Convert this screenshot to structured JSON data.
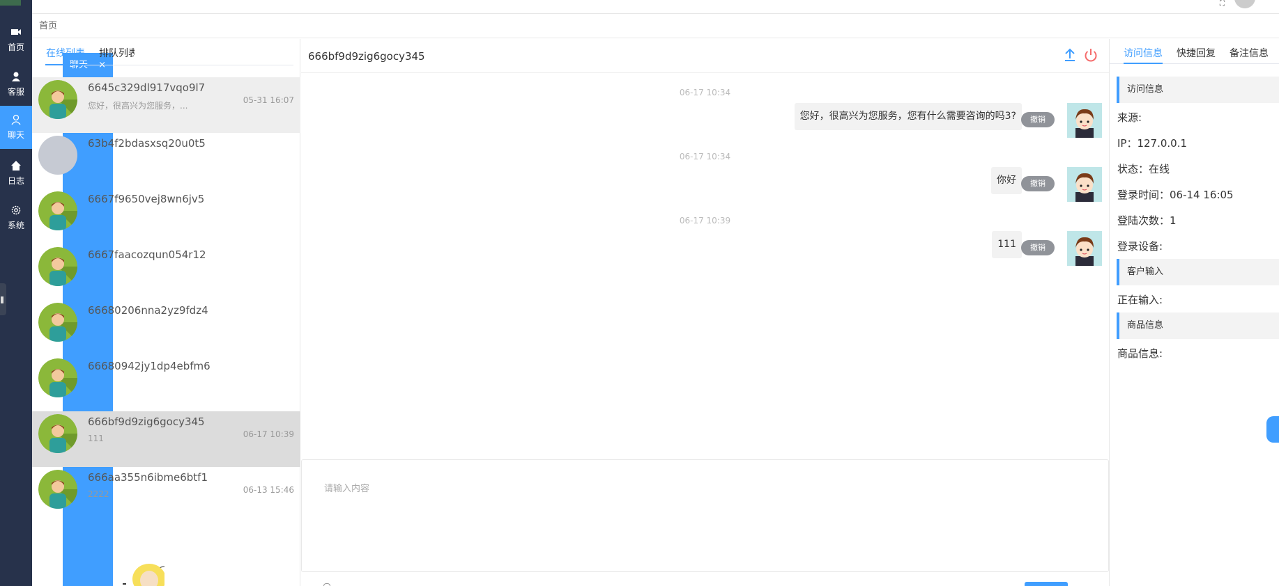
{
  "nav": {
    "items": [
      {
        "label": "首页",
        "icon": "video-camera-icon"
      },
      {
        "label": "客服",
        "icon": "user-filled-icon"
      },
      {
        "label": "聊天",
        "icon": "user-icon"
      },
      {
        "label": "日志",
        "icon": "home-icon"
      },
      {
        "label": "系统",
        "icon": "gear-icon"
      }
    ]
  },
  "tabs": {
    "home": "首页",
    "chat": "聊天",
    "close": "×"
  },
  "list": {
    "tabs": [
      "在线列表",
      "排队列表"
    ],
    "items": [
      {
        "name": "6645c329dl917vqo9l7",
        "preview": "您好，很高兴为您服务，...",
        "time": "05-31 16:07"
      },
      {
        "name": "63b4f2bdasxsq20u0t5",
        "preview": "",
        "time": ""
      },
      {
        "name": "6667f9650vej8wn6jv5",
        "preview": "",
        "time": ""
      },
      {
        "name": "6667faacozqun054r12",
        "preview": "",
        "time": ""
      },
      {
        "name": "66680206nna2yz9fdz4",
        "preview": "",
        "time": ""
      },
      {
        "name": "66680942jy1dp4ebfm6",
        "preview": "",
        "time": ""
      },
      {
        "name": "666bf9d9zig6gocy345",
        "preview": "111",
        "time": "06-17 10:39"
      },
      {
        "name": "666aa355n6ibme6btf1",
        "preview": "2222",
        "time": "06-13 15:46"
      }
    ]
  },
  "chat": {
    "title": "666bf9d9zig6gocy345",
    "messages": [
      {
        "time": "06-17 10:34",
        "text": "您好，很高兴为您服务，您有什么需要咨询的吗3?",
        "revoke": "撤销"
      },
      {
        "time": "06-17 10:34",
        "text": "你好",
        "revoke": "撤销"
      },
      {
        "time": "06-17 10:39",
        "text": "111",
        "revoke": "撤销"
      }
    ],
    "input_placeholder": "请输入内容"
  },
  "info": {
    "tabs": [
      "访问信息",
      "快捷回复",
      "备注信息"
    ],
    "section_visit": "访问信息",
    "source": "来源:",
    "ip": "IP：127.0.0.1",
    "status": "状态：在线",
    "login_time": "登录时间：06-14 16:05",
    "login_count": "登陆次数：1",
    "device": "登录设备:",
    "section_input": "客户输入",
    "typing": "正在输入:",
    "section_goods": "商品信息",
    "goods": "商品信息:"
  },
  "colors": {
    "nav_bg": "#27324b",
    "accent": "#409eff",
    "danger": "#f56c6c"
  }
}
